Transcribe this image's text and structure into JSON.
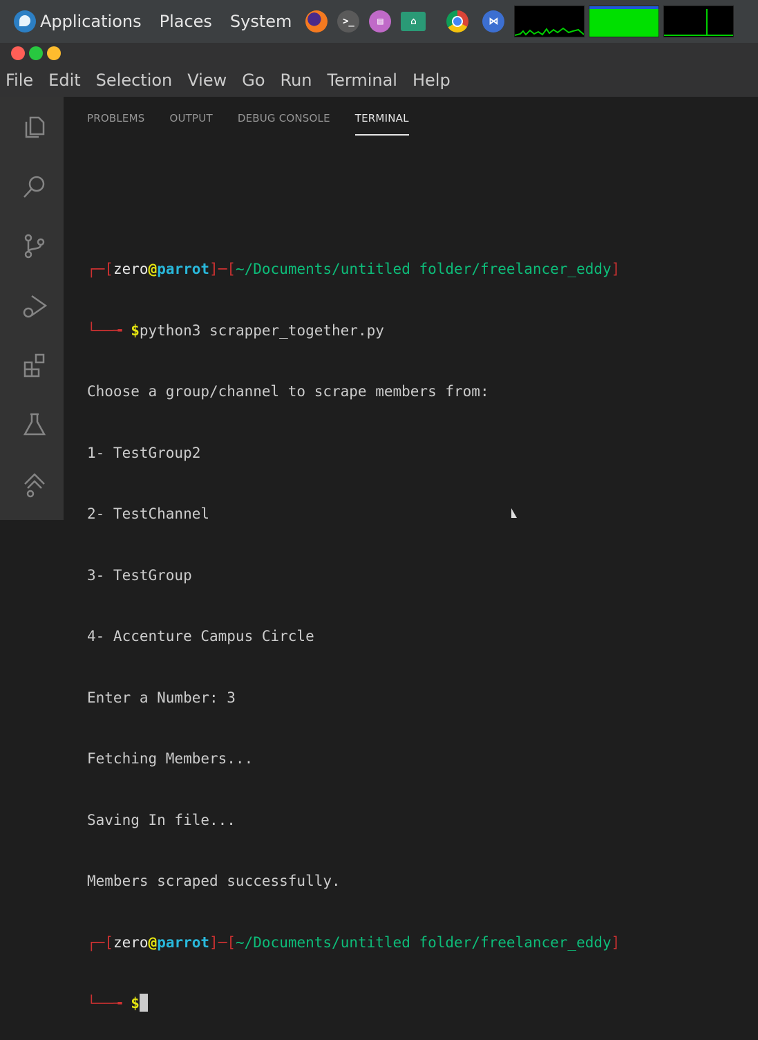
{
  "top_panel": {
    "menus": [
      "Applications",
      "Places",
      "System"
    ],
    "launchers": [
      "firefox-icon",
      "terminal-icon",
      "text-editor-icon",
      "files-icon",
      "chrome-icon",
      "vscode-icon"
    ],
    "monitors": [
      "cpu-monitor",
      "memory-monitor",
      "network-monitor"
    ]
  },
  "window_controls": [
    "close",
    "maximize",
    "minimize"
  ],
  "menubar": [
    "File",
    "Edit",
    "Selection",
    "View",
    "Go",
    "Run",
    "Terminal",
    "Help"
  ],
  "activity_bar": [
    "explorer-icon",
    "search-icon",
    "source-control-icon",
    "run-debug-icon",
    "extensions-icon",
    "testing-icon",
    "remote-icon"
  ],
  "panel": {
    "tabs": [
      "PROBLEMS",
      "OUTPUT",
      "DEBUG CONSOLE",
      "TERMINAL"
    ],
    "active_tab": "TERMINAL"
  },
  "terminal": {
    "prompt1": {
      "open_bracket": "[",
      "user": "zero",
      "at": "@",
      "host": "parrot",
      "mid": "]─[",
      "path": "~/Documents/untitled folder/freelancer_eddy",
      "close_bracket": "]",
      "symbol": "$",
      "command": "python3 scrapper_together.py"
    },
    "output": [
      "Choose a group/channel to scrape members from:",
      "1- TestGroup2",
      "2- TestChannel",
      "3- TestGroup",
      "4- Accenture Campus Circle",
      "Enter a Number: 3",
      "Fetching Members...",
      "Saving In file...",
      "Members scraped successfully."
    ],
    "prompt2": {
      "open_bracket": "[",
      "user": "zero",
      "at": "@",
      "host": "parrot",
      "mid": "]─[",
      "path": "~/Documents/untitled folder/freelancer_eddy",
      "close_bracket": "]",
      "symbol": "$"
    }
  },
  "colors": {
    "terminal_bg": "#1e1e1e",
    "bracket": "#cd3131",
    "host": "#29b8db",
    "path": "#0dbc79",
    "prompt": "#e5e510"
  }
}
